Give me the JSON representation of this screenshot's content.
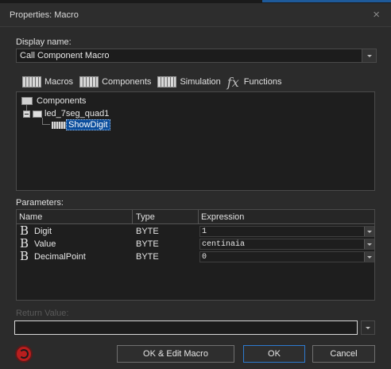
{
  "window": {
    "title": "Properties: Macro",
    "close_icon": "close-icon"
  },
  "display_name": {
    "label": "Display name:",
    "value": "Call Component Macro"
  },
  "tabs": [
    {
      "label": "Macros",
      "icon": "macros-icon"
    },
    {
      "label": "Components",
      "icon": "components-icon"
    },
    {
      "label": "Simulation",
      "icon": "simulation-icon"
    },
    {
      "label": "Functions",
      "icon": "fx-icon"
    }
  ],
  "tree": {
    "root": "Components",
    "component": "led_7seg_quad1",
    "macro": "ShowDigit"
  },
  "parameters": {
    "label": "Parameters:",
    "columns": [
      "Name",
      "Type",
      "Expression"
    ],
    "rows": [
      {
        "name": "Digit",
        "type": "BYTE",
        "expression": "1"
      },
      {
        "name": "Value",
        "type": "BYTE",
        "expression": "centinaia"
      },
      {
        "name": "DecimalPoint",
        "type": "BYTE",
        "expression": "0"
      }
    ]
  },
  "return_value": {
    "label": "Return Value:",
    "value": ""
  },
  "buttons": {
    "ok_edit": "OK & Edit Macro",
    "ok": "OK",
    "cancel": "Cancel"
  },
  "colors": {
    "selection": "#0a4d9c",
    "accent_border": "#2e7bd0",
    "help": "#b81e1e"
  }
}
